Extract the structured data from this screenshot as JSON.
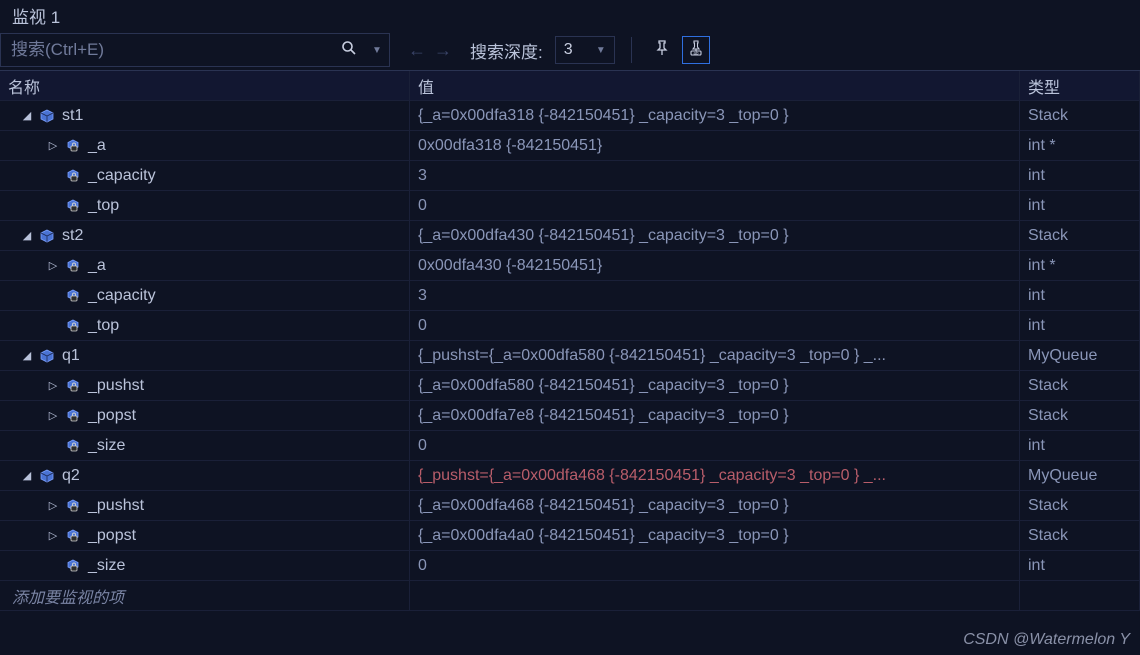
{
  "title": "监视 1",
  "search": {
    "placeholder": "搜索(Ctrl+E)"
  },
  "depth": {
    "label": "搜索深度:",
    "value": "3"
  },
  "columns": {
    "name": "名称",
    "value": "值",
    "type": "类型"
  },
  "placeholder_row": "添加要监视的项",
  "watermark": "CSDN @Watermelon Y",
  "rows": [
    {
      "indent": 0,
      "expander": "open",
      "icon": "object",
      "name": "st1",
      "value": "{_a=0x00dfa318 {-842150451} _capacity=3 _top=0 }",
      "type": "Stack"
    },
    {
      "indent": 1,
      "expander": "closed",
      "icon": "field",
      "name": "_a",
      "value": "0x00dfa318 {-842150451}",
      "type": "int *"
    },
    {
      "indent": 1,
      "expander": "none",
      "icon": "field",
      "name": "_capacity",
      "value": "3",
      "type": "int"
    },
    {
      "indent": 1,
      "expander": "none",
      "icon": "field",
      "name": "_top",
      "value": "0",
      "type": "int"
    },
    {
      "indent": 0,
      "expander": "open",
      "icon": "object",
      "name": "st2",
      "value": "{_a=0x00dfa430 {-842150451} _capacity=3 _top=0 }",
      "type": "Stack"
    },
    {
      "indent": 1,
      "expander": "closed",
      "icon": "field",
      "name": "_a",
      "value": "0x00dfa430 {-842150451}",
      "type": "int *"
    },
    {
      "indent": 1,
      "expander": "none",
      "icon": "field",
      "name": "_capacity",
      "value": "3",
      "type": "int"
    },
    {
      "indent": 1,
      "expander": "none",
      "icon": "field",
      "name": "_top",
      "value": "0",
      "type": "int"
    },
    {
      "indent": 0,
      "expander": "open",
      "icon": "object",
      "name": "q1",
      "value": "{_pushst={_a=0x00dfa580 {-842150451} _capacity=3 _top=0 } _...",
      "type": "MyQueue"
    },
    {
      "indent": 1,
      "expander": "closed",
      "icon": "field",
      "name": "_pushst",
      "value": "{_a=0x00dfa580 {-842150451} _capacity=3 _top=0 }",
      "type": "Stack"
    },
    {
      "indent": 1,
      "expander": "closed",
      "icon": "field",
      "name": "_popst",
      "value": "{_a=0x00dfa7e8 {-842150451} _capacity=3 _top=0 }",
      "type": "Stack"
    },
    {
      "indent": 1,
      "expander": "none",
      "icon": "field",
      "name": "_size",
      "value": "0",
      "type": "int"
    },
    {
      "indent": 0,
      "expander": "open",
      "icon": "object",
      "name": "q2",
      "value": "{_pushst={_a=0x00dfa468 {-842150451} _capacity=3 _top=0 } _...",
      "type": "MyQueue",
      "highlight": true
    },
    {
      "indent": 1,
      "expander": "closed",
      "icon": "field",
      "name": "_pushst",
      "value": "{_a=0x00dfa468 {-842150451} _capacity=3 _top=0 }",
      "type": "Stack"
    },
    {
      "indent": 1,
      "expander": "closed",
      "icon": "field",
      "name": "_popst",
      "value": "{_a=0x00dfa4a0 {-842150451} _capacity=3 _top=0 }",
      "type": "Stack"
    },
    {
      "indent": 1,
      "expander": "none",
      "icon": "field",
      "name": "_size",
      "value": "0",
      "type": "int"
    }
  ]
}
